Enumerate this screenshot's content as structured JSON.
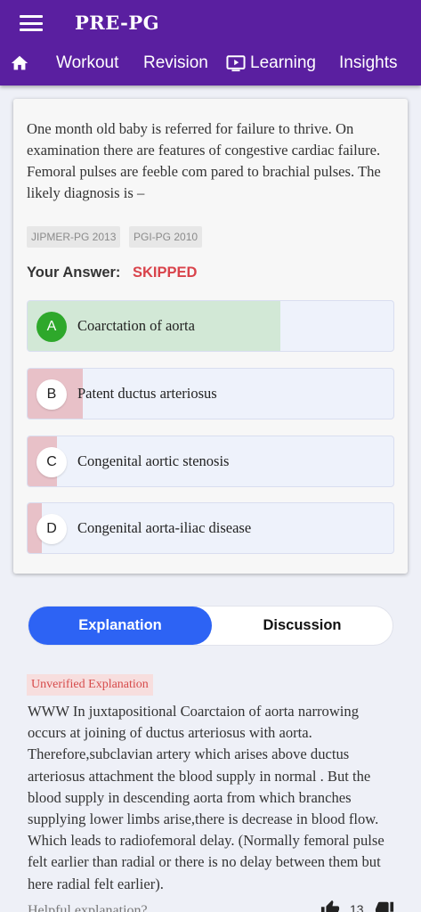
{
  "app": {
    "title": "PRE-PG",
    "nav": [
      "Workout",
      "Revision",
      "Learning",
      "Insights"
    ]
  },
  "question": {
    "text": "One month old baby is referred for failure to thrive. On examination there are features of congestive cardiac failure. Femoral pulses are feeble com pared to brachial pulses. The likely diagnosis is –",
    "tags": [
      "JIPMER-PG 2013",
      "PGI-PG 2010"
    ],
    "your_answer_label": "Your Answer:",
    "your_answer_value": "SKIPPED",
    "options": [
      {
        "letter": "A",
        "text": "Coarctation of aorta",
        "share": 0.69,
        "correct": true
      },
      {
        "letter": "B",
        "text": "Patent ductus arteriosus",
        "share": 0.15,
        "correct": false
      },
      {
        "letter": "C",
        "text": "Congenital aortic stenosis",
        "share": 0.08,
        "correct": false
      },
      {
        "letter": "D",
        "text": "Congenital aorta-iliac disease",
        "share": 0.04,
        "correct": false
      }
    ]
  },
  "tabs": {
    "active": "Explanation",
    "other": "Discussion"
  },
  "explanation": {
    "badge": "Unverified Explanation",
    "text": "WWW In juxtapositional Coarctaion of aorta narrowing occurs at joining of ductus arteriosus with aorta. Therefore,subclavian artery which arises above ductus arteriosus attachment the blood supply in normal . But the blood supply in descending aorta from which branches supplying lower limbs arise,there is decrease in blood flow. Which leads to radiofemoral delay. (Normally femoral pulse felt earlier than radial or there is no delay between them but here radial felt earlier).",
    "helpful_prompt": "Helpful explanation?",
    "like_count": "13"
  },
  "colors": {
    "appbar": "#5a1fa0",
    "accent": "#2d63f4",
    "correct_fill": "#d2e8d6",
    "wrong_fill": "#e8c1c8",
    "skipped": "#d9434b"
  },
  "icons": [
    "hamburger-menu-icon",
    "home-icon",
    "tv-play-icon",
    "thumbs-up-icon",
    "thumbs-down-icon"
  ]
}
